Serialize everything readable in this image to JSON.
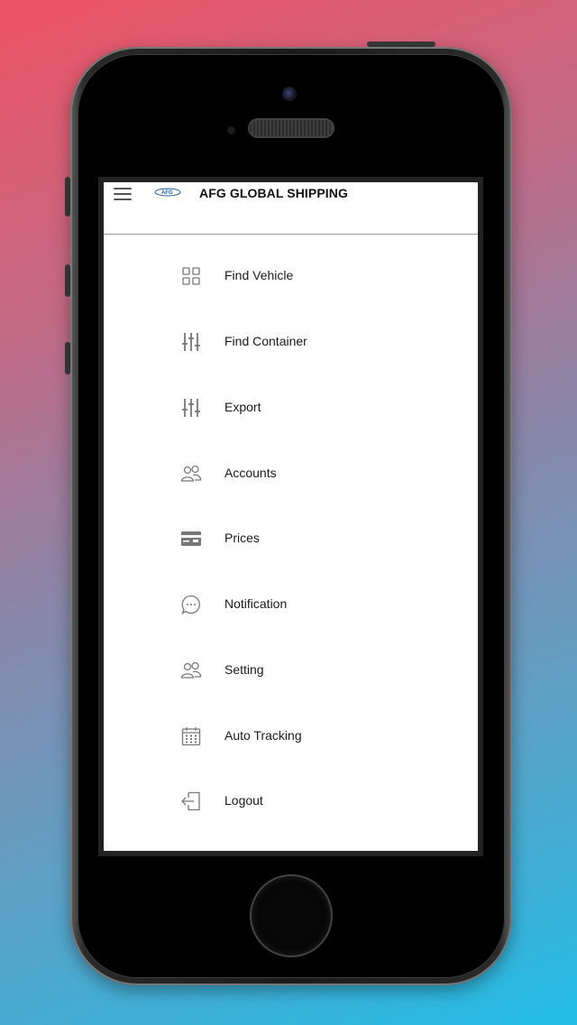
{
  "header": {
    "title": "AFG GLOBAL SHIPPING",
    "logo_text": "AFG",
    "menu_icon": "hamburger-menu-icon"
  },
  "menu": {
    "items": [
      {
        "label": "Find Vehicle",
        "icon": "grid-icon"
      },
      {
        "label": "Find Container",
        "icon": "sliders-icon"
      },
      {
        "label": "Export",
        "icon": "sliders-icon"
      },
      {
        "label": "Accounts",
        "icon": "users-icon"
      },
      {
        "label": "Prices",
        "icon": "credit-card-icon"
      },
      {
        "label": "Notification",
        "icon": "chat-bubble-icon"
      },
      {
        "label": "Setting",
        "icon": "users-icon"
      },
      {
        "label": "Auto Tracking",
        "icon": "calendar-icon"
      },
      {
        "label": "Logout",
        "icon": "logout-icon"
      }
    ]
  },
  "colors": {
    "icon": "#777777",
    "text": "#1a1a1a",
    "divider": "#9a9a9a",
    "logo_blue": "#1c5aa6"
  }
}
